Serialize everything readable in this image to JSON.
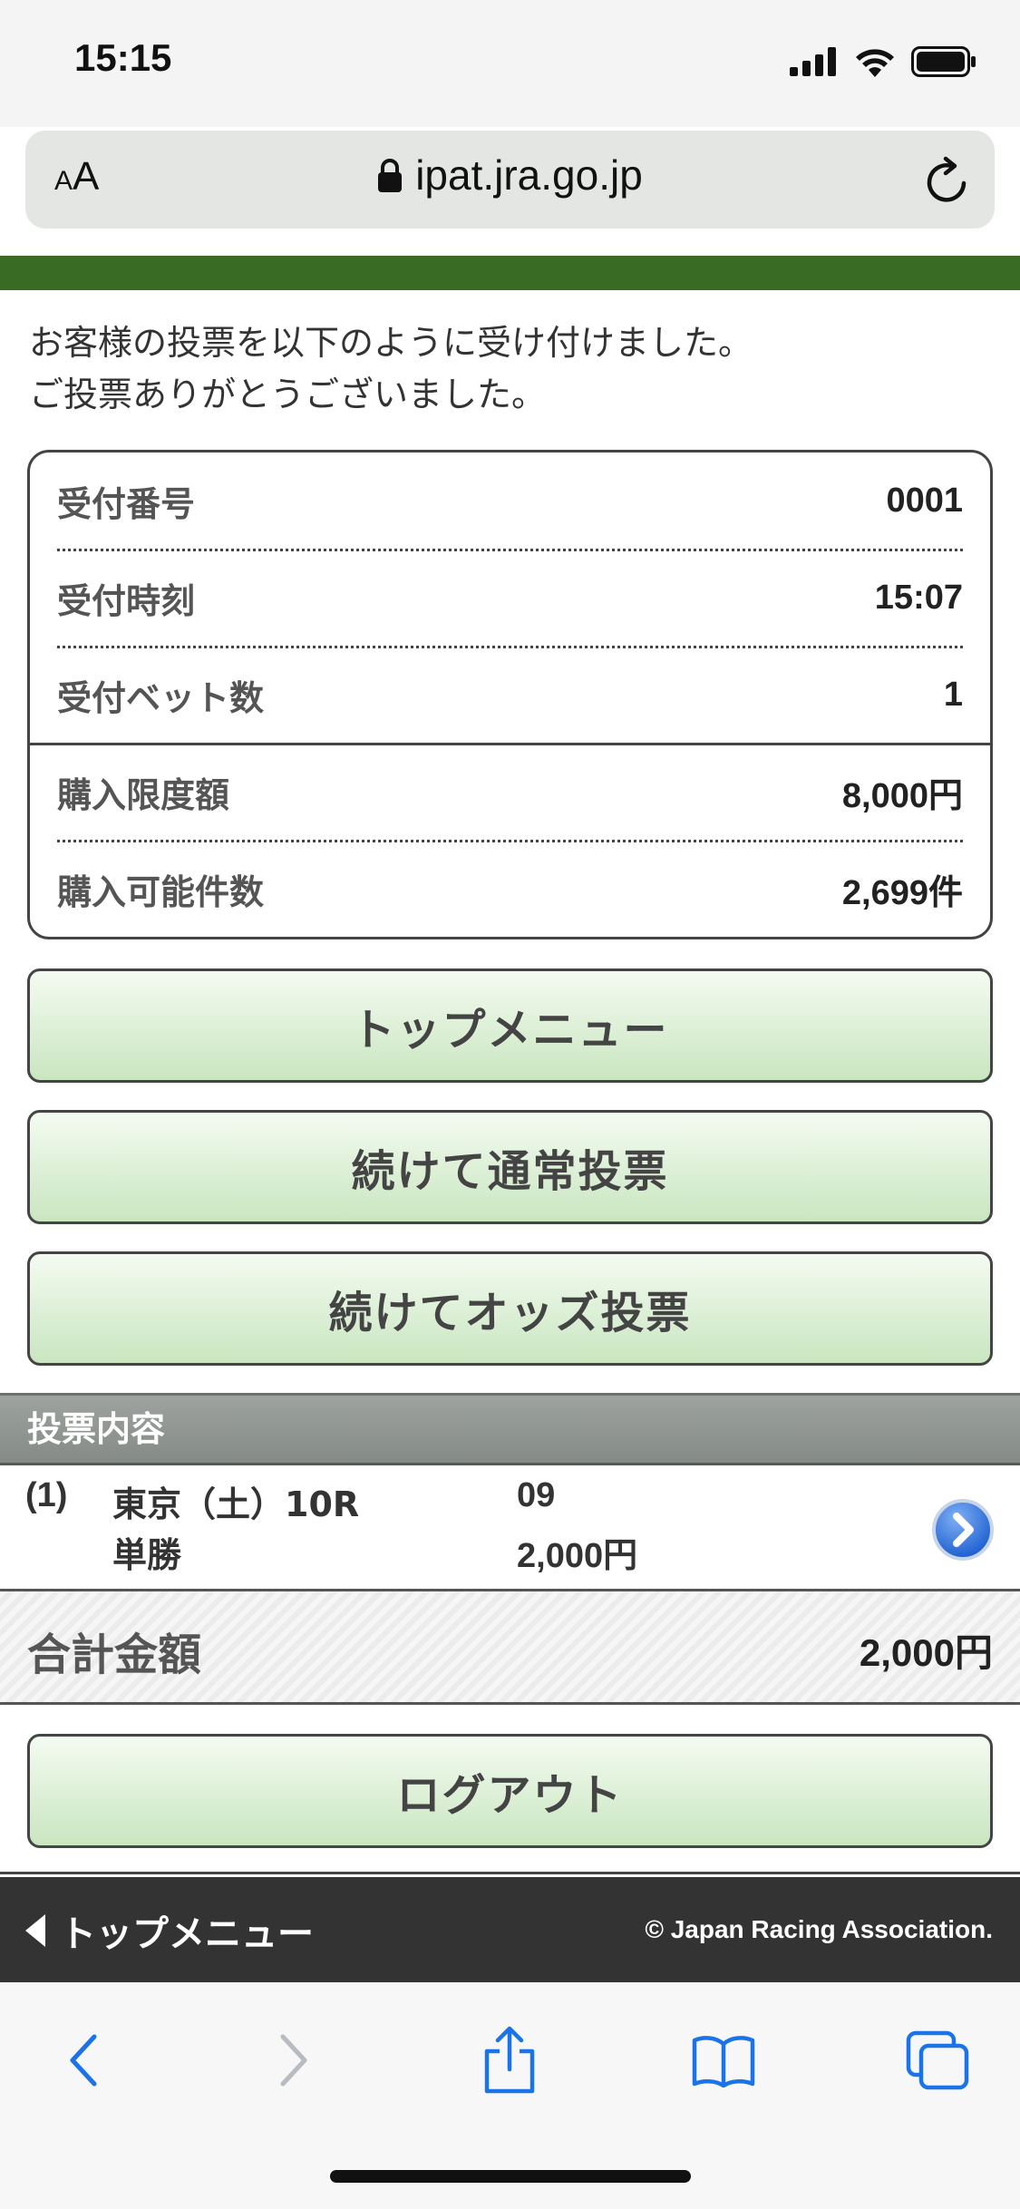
{
  "status_bar": {
    "time": "15:15"
  },
  "browser": {
    "text_size_small": "A",
    "text_size_big": "A",
    "url": "ipat.jra.go.jp"
  },
  "intro": {
    "line1": "お客様の投票を以下のように受け付けました。",
    "line2": "ご投票ありがとうございました。"
  },
  "receipt": {
    "rows": [
      {
        "label": "受付番号",
        "value": "0001"
      },
      {
        "label": "受付時刻",
        "value": "15:07"
      },
      {
        "label": "受付ベット数",
        "value": "1"
      },
      {
        "label": "購入限度額",
        "value": "8,000円"
      },
      {
        "label": "購入可能件数",
        "value": "2,699件"
      }
    ]
  },
  "buttons": {
    "top_menu": "トップメニュー",
    "continue_normal": "続けて通常投票",
    "continue_odds": "続けてオッズ投票",
    "logout": "ログアウト"
  },
  "vote_content": {
    "header": "投票内容",
    "bets": [
      {
        "index": "(1)",
        "race": "東京（土）10R",
        "bet_type": "単勝",
        "horse": "09",
        "amount": "2,000円"
      }
    ]
  },
  "total": {
    "label": "合計金額",
    "value": "2,000円"
  },
  "footer": {
    "back_label": "トップメニュー",
    "copyright": "© Japan Racing Association."
  },
  "colors": {
    "accent_green": "#3a6b25",
    "button_gradient_top": "#f4fbf1",
    "button_gradient_bottom": "#c9e6c0",
    "ios_blue": "#1a73e8"
  }
}
